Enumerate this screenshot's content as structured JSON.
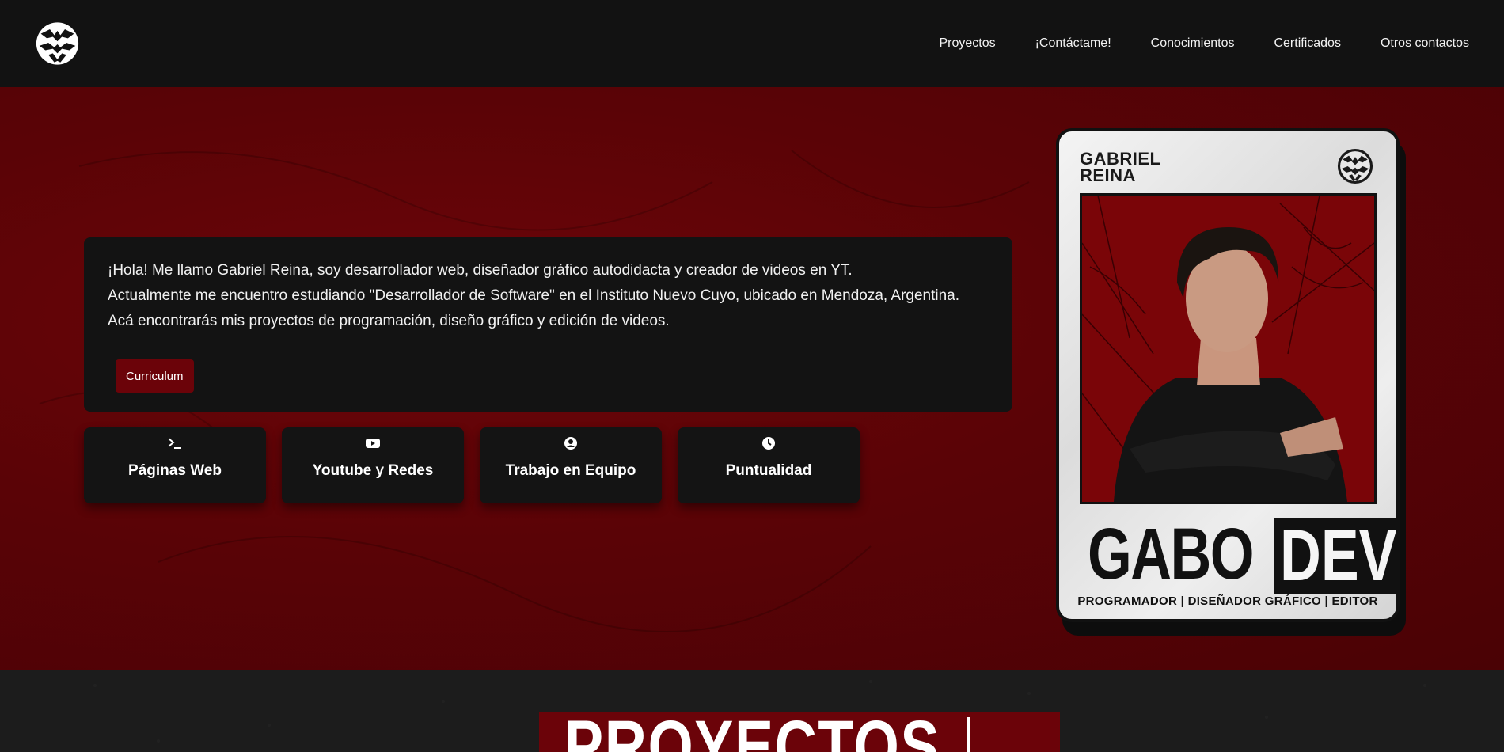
{
  "nav": {
    "links": [
      "Proyectos",
      "¡Contáctame!",
      "Conocimientos",
      "Certificados",
      "Otros contactos"
    ]
  },
  "intro": {
    "lines": [
      "¡Hola! Me llamo Gabriel Reina, soy desarrollador web, diseñador gráfico autodidacta y creador de videos en YT.",
      "Actualmente me encuentro estudiando \"Desarrollador de Software\" en el Instituto Nuevo Cuyo, ubicado en Mendoza, Argentina.",
      "Acá encontrarás mis proyectos de programación, diseño gráfico y edición de videos."
    ],
    "cv_button": "Curriculum"
  },
  "skills": [
    {
      "label": "Páginas Web",
      "icon": "terminal-icon"
    },
    {
      "label": "Youtube y Redes",
      "icon": "youtube-icon"
    },
    {
      "label": "Trabajo en Equipo",
      "icon": "user-circle-icon"
    },
    {
      "label": "Puntualidad",
      "icon": "clock-icon"
    }
  ],
  "card": {
    "first_name": "GABRIEL",
    "last_name": "REINA",
    "title_left": "GABO",
    "title_right": "DEV",
    "subtitle": "PROGRAMADOR | DISEÑADOR GRÁFICO | EDITOR"
  },
  "projects": {
    "heading": "PROYECTOS"
  },
  "colors": {
    "accent": "#6b0309",
    "hero_bg": "#5a0306",
    "card_bg": "#131313",
    "navbar_bg": "#121212"
  }
}
